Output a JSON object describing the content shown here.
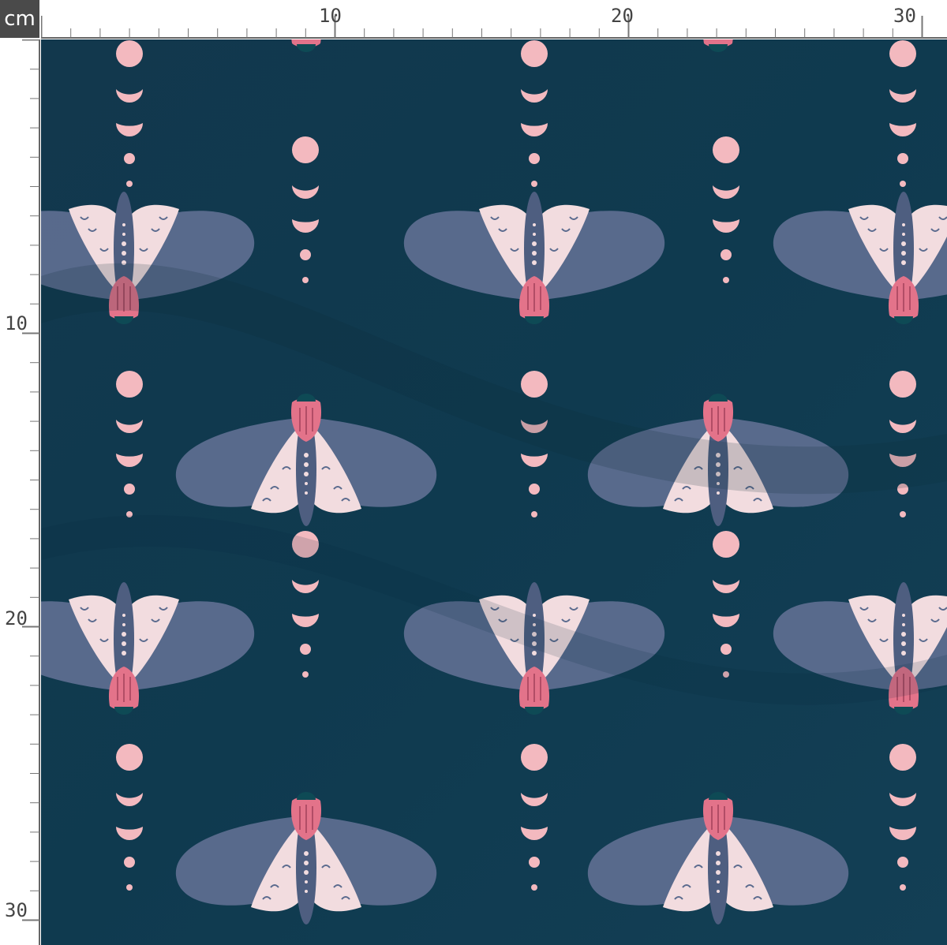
{
  "ruler": {
    "unit": "cm",
    "top_labels": [
      "10",
      "20",
      "30"
    ],
    "left_labels": [
      "10",
      "20",
      "30"
    ]
  },
  "fabric": {
    "background_color": "#0f3a4f",
    "moth_wing_color": "#5b6b8e",
    "moth_inner_color": "#f2dcdf",
    "moth_head_color": "#e3738a",
    "moon_color": "#f3b9bf",
    "motifs": [
      "moth-icon",
      "moon-phase-icon"
    ]
  }
}
